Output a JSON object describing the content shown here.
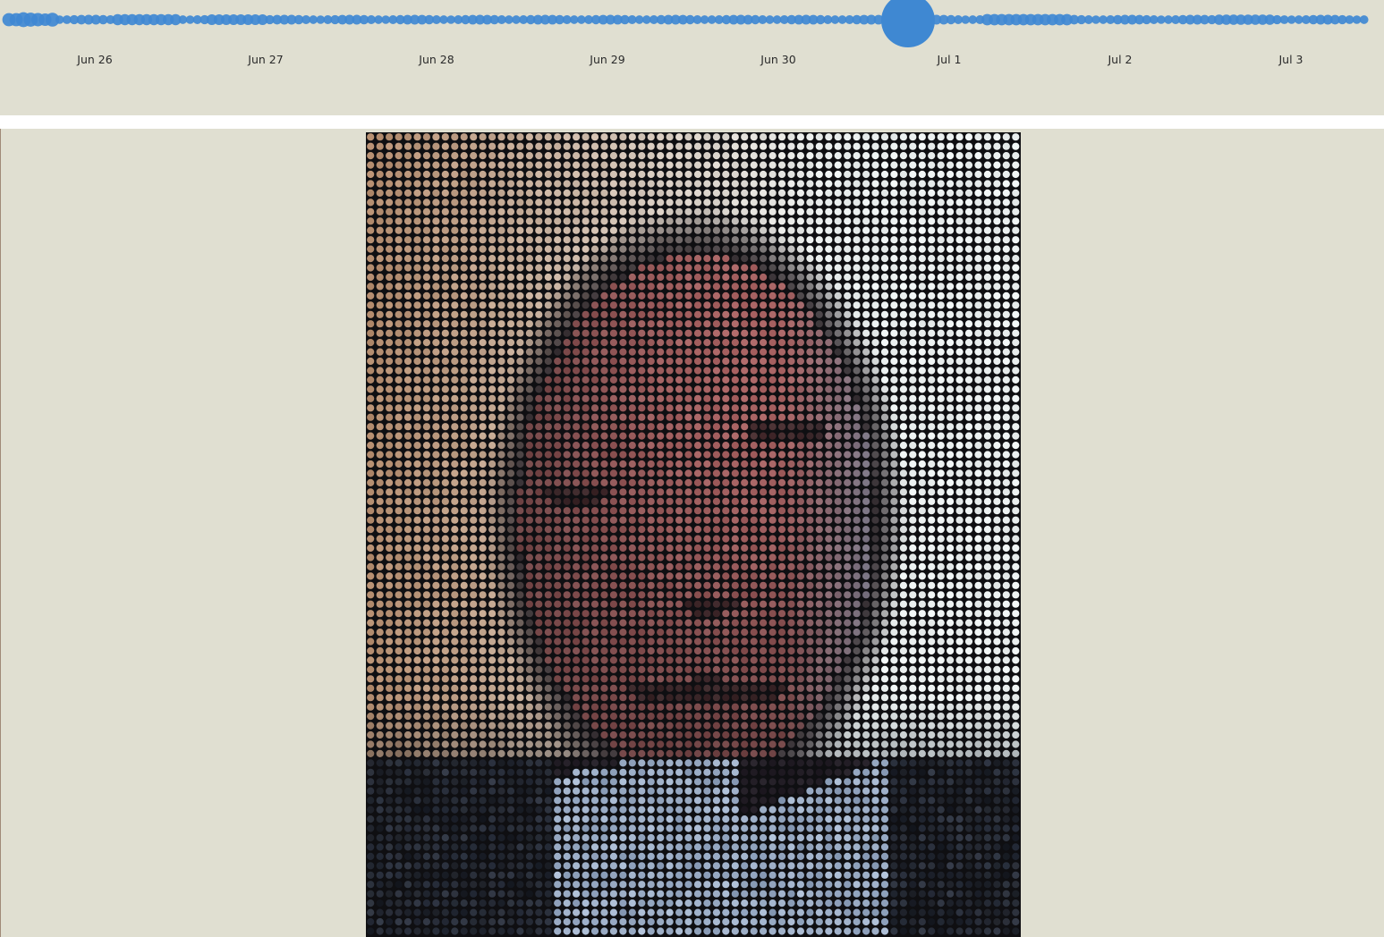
{
  "timeline": {
    "ticks": [
      "Jun 26",
      "Jun 27",
      "Jun 28",
      "Jun 29",
      "Jun 30",
      "Jul 1",
      "Jul 2",
      "Jul 3"
    ],
    "selected_date": "Jul 1",
    "accent_color": "#3f88d2"
  },
  "portrait": {
    "style": "dot-mosaic",
    "dot_color_dark": "#1a1a20",
    "background_color": "#0f0f12"
  }
}
